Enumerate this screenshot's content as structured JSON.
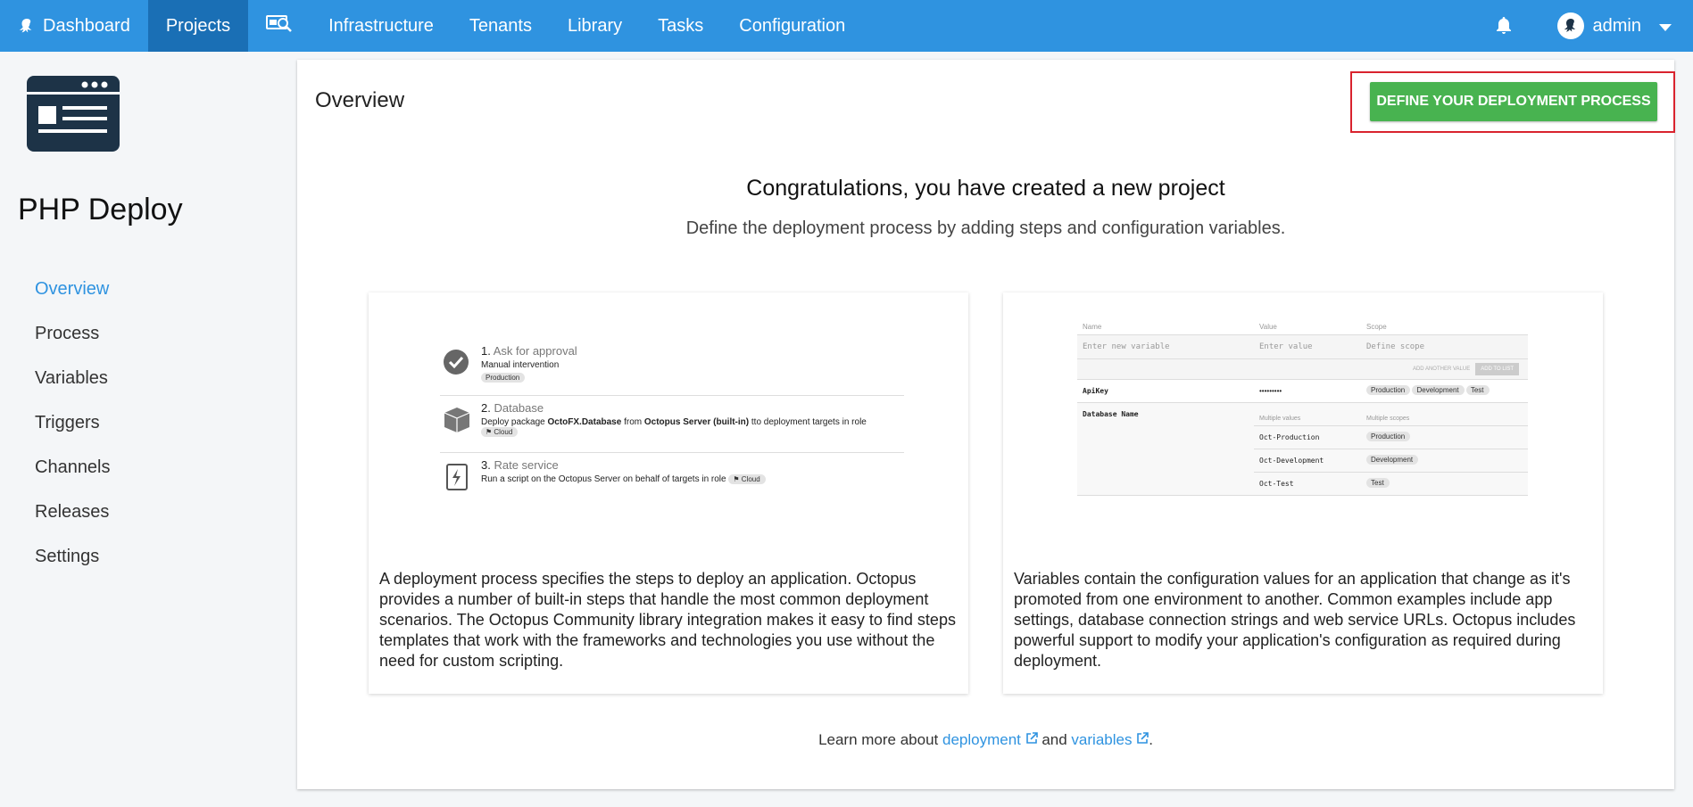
{
  "nav": {
    "items": [
      {
        "label": "Dashboard",
        "icon": "octopus-icon",
        "active": false
      },
      {
        "label": "Projects",
        "active": true
      },
      {
        "label": "",
        "icon": "search-icon",
        "active": false
      },
      {
        "label": "Infrastructure",
        "active": false
      },
      {
        "label": "Tenants",
        "active": false
      },
      {
        "label": "Library",
        "active": false
      },
      {
        "label": "Tasks",
        "active": false
      },
      {
        "label": "Configuration",
        "active": false
      }
    ],
    "user": "admin"
  },
  "sidebar": {
    "project_name": "PHP Deploy",
    "items": [
      {
        "label": "Overview",
        "active": true
      },
      {
        "label": "Process"
      },
      {
        "label": "Variables"
      },
      {
        "label": "Triggers"
      },
      {
        "label": "Channels"
      },
      {
        "label": "Releases"
      },
      {
        "label": "Settings"
      }
    ]
  },
  "main": {
    "title": "Overview",
    "define_button": "DEFINE YOUR DEPLOYMENT PROCESS",
    "congrats": "Congratulations, you have created a new project",
    "subtitle": "Define the deployment process by adding steps and configuration variables.",
    "process_card": {
      "steps": [
        {
          "num": "1.",
          "name": "Ask for approval",
          "desc": "Manual intervention",
          "chip": "Production"
        },
        {
          "num": "2.",
          "name": "Database",
          "desc_pre": "Deploy package ",
          "pkg": "OctoFX.Database",
          "desc_mid": " from ",
          "src": "Octopus Server (built-in)",
          "desc_post": " tto deployment targets in role ",
          "chip": "Cloud"
        },
        {
          "num": "3.",
          "name": "Rate service",
          "desc": "Run a script on the Octopus Server on behalf of targets in role ",
          "chip": "Cloud"
        }
      ],
      "text": "A deployment process specifies the steps to deploy an application. Octopus provides a number of built-in steps that handle the most common deployment scenarios. The Octopus Community library integration makes it easy to find steps templates that work with the frameworks and technologies you use without the need for custom scripting."
    },
    "variables_card": {
      "headers": [
        "Name",
        "Value",
        "Scope"
      ],
      "placeholders": [
        "Enter new variable",
        "Enter value",
        "Define scope"
      ],
      "add_another": "ADD ANOTHER VALUE",
      "add_to_list": "ADD TO LIST",
      "apikey": {
        "name": "ApiKey",
        "value": "•••••••••",
        "scopes": [
          "Production",
          "Development",
          "Test"
        ]
      },
      "dbname": {
        "name": "Database Name",
        "sub_headers": [
          "Multiple values",
          "Multiple scopes"
        ],
        "rows": [
          {
            "value": "Oct-Production",
            "scope": "Production"
          },
          {
            "value": "Oct-Development",
            "scope": "Development"
          },
          {
            "value": "Oct-Test",
            "scope": "Test"
          }
        ]
      },
      "text": "Variables contain the configuration values for an application that change as it's promoted from one environment to another. Common examples include app settings, database connection strings and web service URLs. Octopus includes powerful support to modify your application's configuration as required during deployment."
    },
    "learn": {
      "pre": "Learn more about ",
      "link1": "deployment",
      "mid": " and ",
      "link2": "variables",
      "post": "."
    }
  }
}
